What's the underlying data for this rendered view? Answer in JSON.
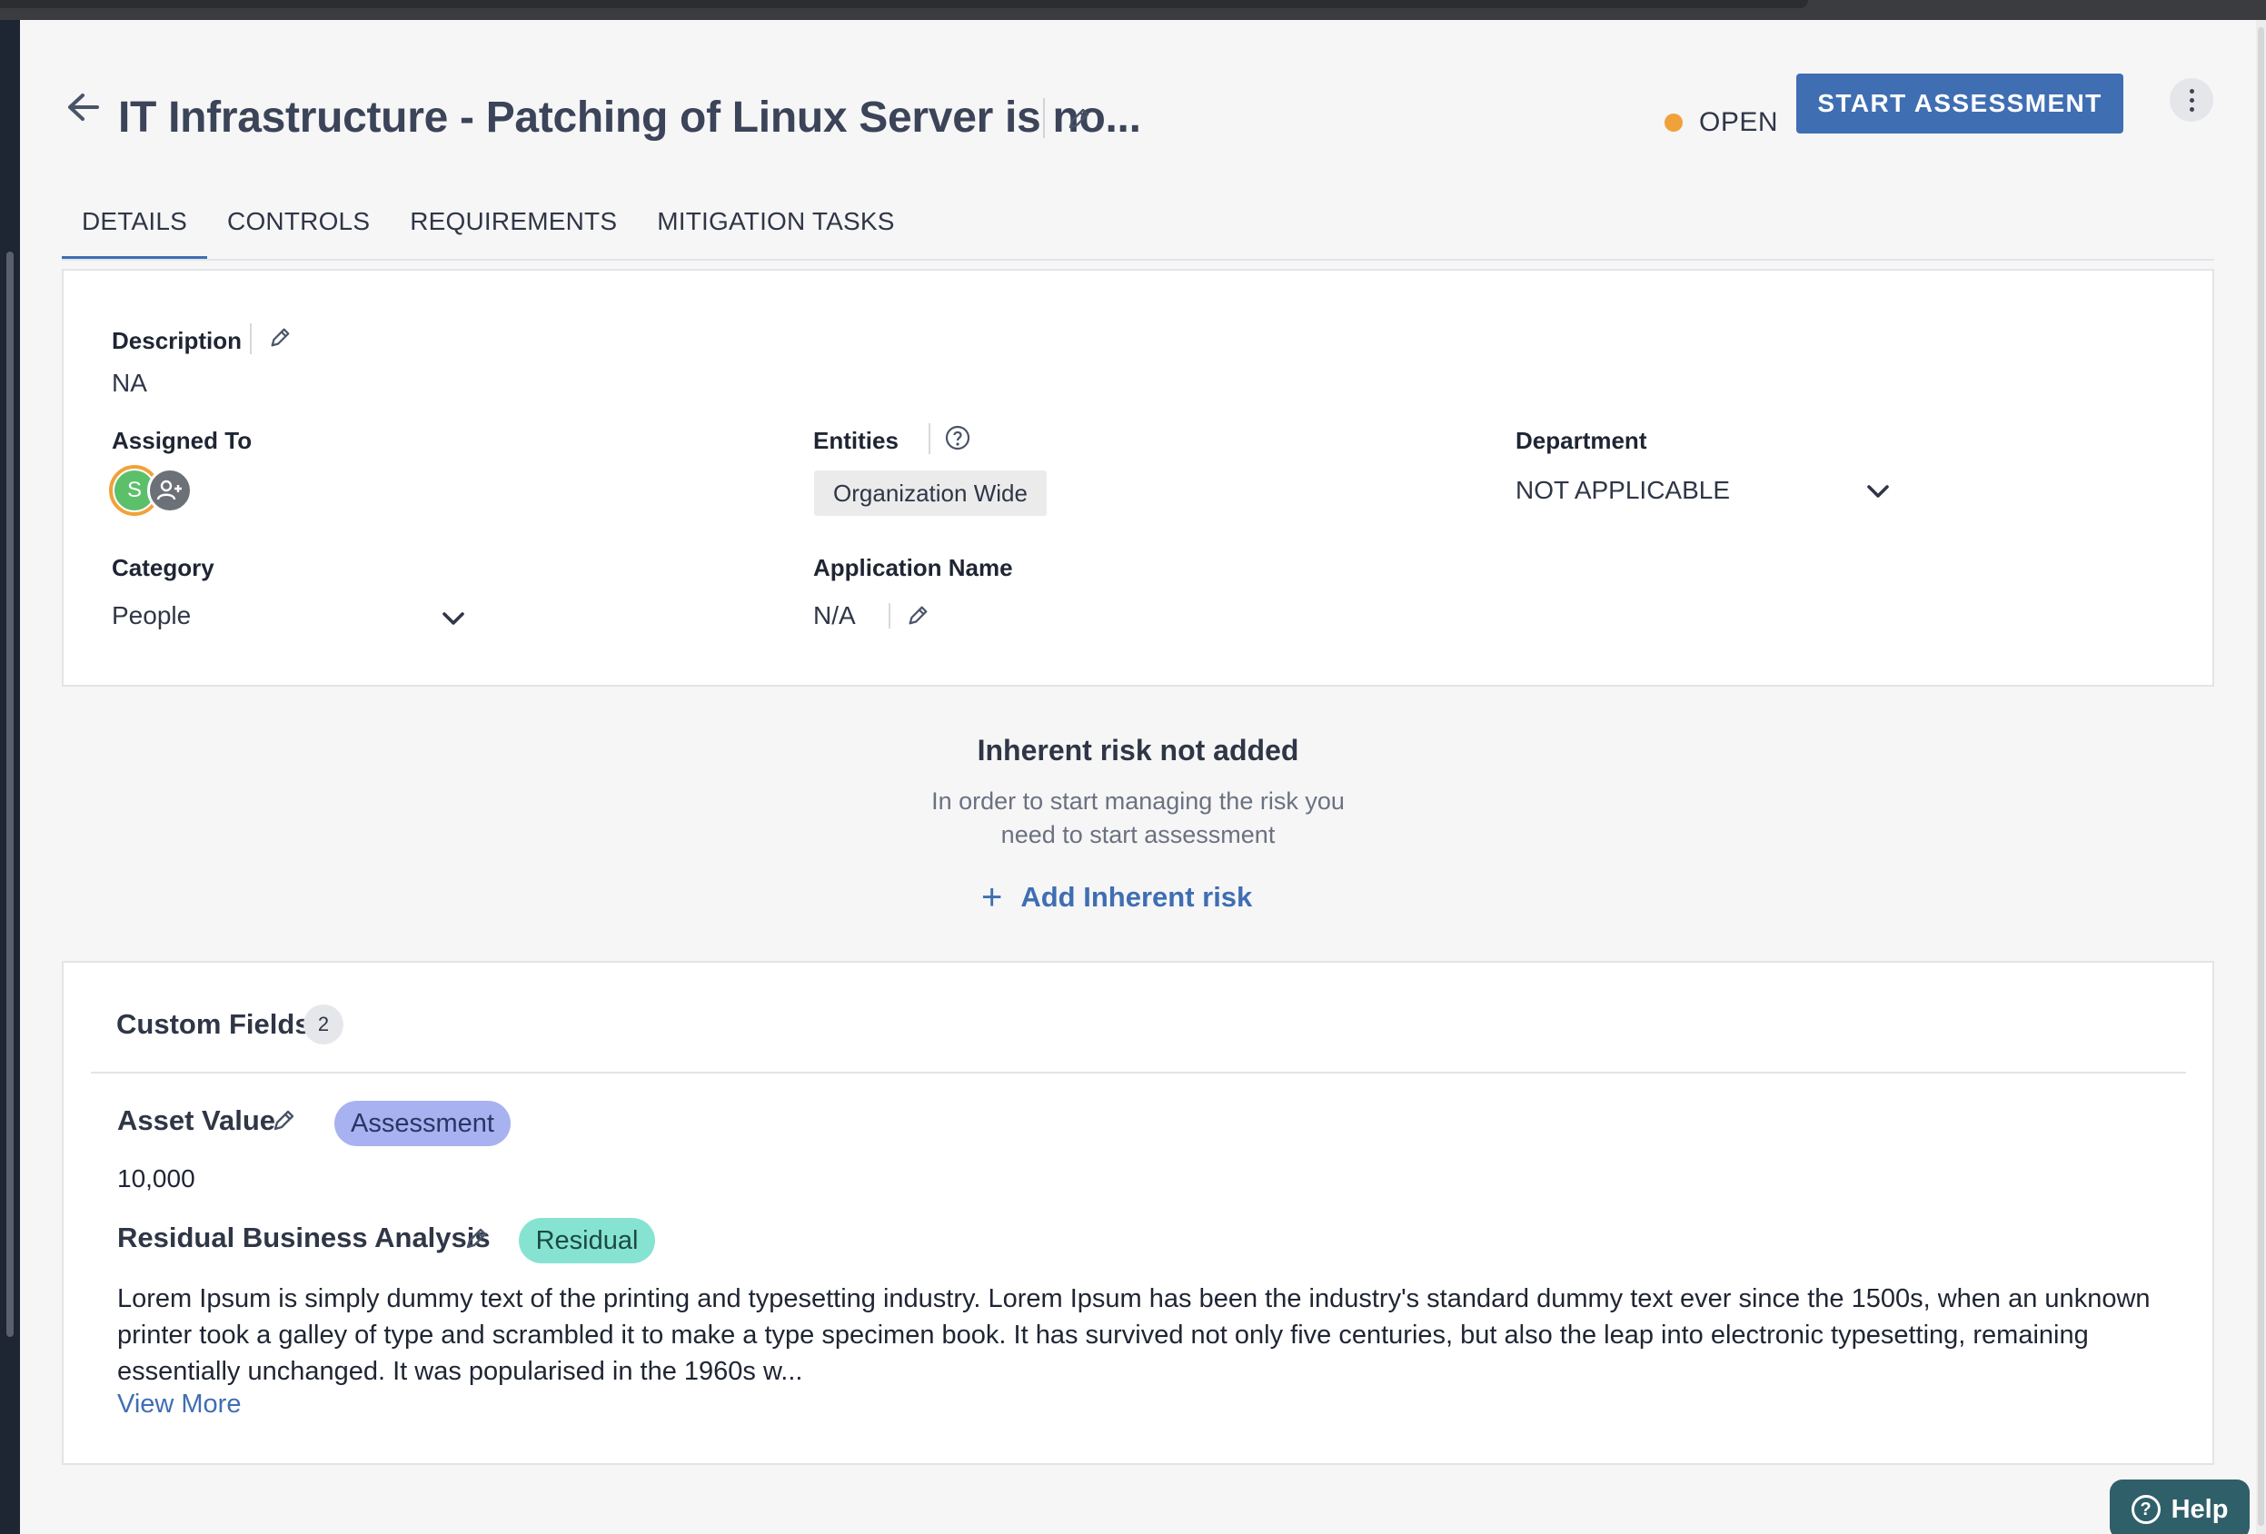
{
  "header": {
    "title": "IT Infrastructure - Patching of Linux Server is no...",
    "status": "OPEN",
    "status_color": "#f0a23a",
    "start_button": "START ASSESSMENT",
    "accent_color": "#3f6eb3"
  },
  "tabs": [
    {
      "label": "DETAILS",
      "active": true
    },
    {
      "label": "CONTROLS",
      "active": false
    },
    {
      "label": "REQUIREMENTS",
      "active": false
    },
    {
      "label": "MITIGATION TASKS",
      "active": false
    }
  ],
  "details": {
    "description_label": "Description",
    "description_value": "NA",
    "assigned_to_label": "Assigned To",
    "assignee_initial": "S",
    "entities_label": "Entities",
    "entities_value": "Organization Wide",
    "department_label": "Department",
    "department_value": "NOT APPLICABLE",
    "category_label": "Category",
    "category_value": "People",
    "application_label": "Application Name",
    "application_value": "N/A"
  },
  "inherent_risk": {
    "title": "Inherent risk not added",
    "line1": "In order to start managing the risk you",
    "line2": "need to start assessment",
    "add_label": "Add Inherent risk"
  },
  "custom_fields": {
    "title": "Custom Fields",
    "count": "2",
    "fields": [
      {
        "name": "Asset Value",
        "tag": "Assessment",
        "tag_color": "#a8b2f0",
        "value": "10,000"
      },
      {
        "name": "Residual Business Analysis",
        "tag": "Residual",
        "tag_color": "#86e3d2",
        "value": "Lorem Ipsum is simply dummy text of the printing and typesetting industry. Lorem Ipsum has been the industry's standard dummy text ever since the 1500s, when an unknown printer took a galley of type and scrambled it to make a type specimen book. It has survived not only five centuries, but also the leap into electronic typesetting, remaining essentially unchanged. It was popularised in the 1960s w..."
      }
    ],
    "view_more": "View More"
  },
  "help": {
    "label": "Help"
  }
}
